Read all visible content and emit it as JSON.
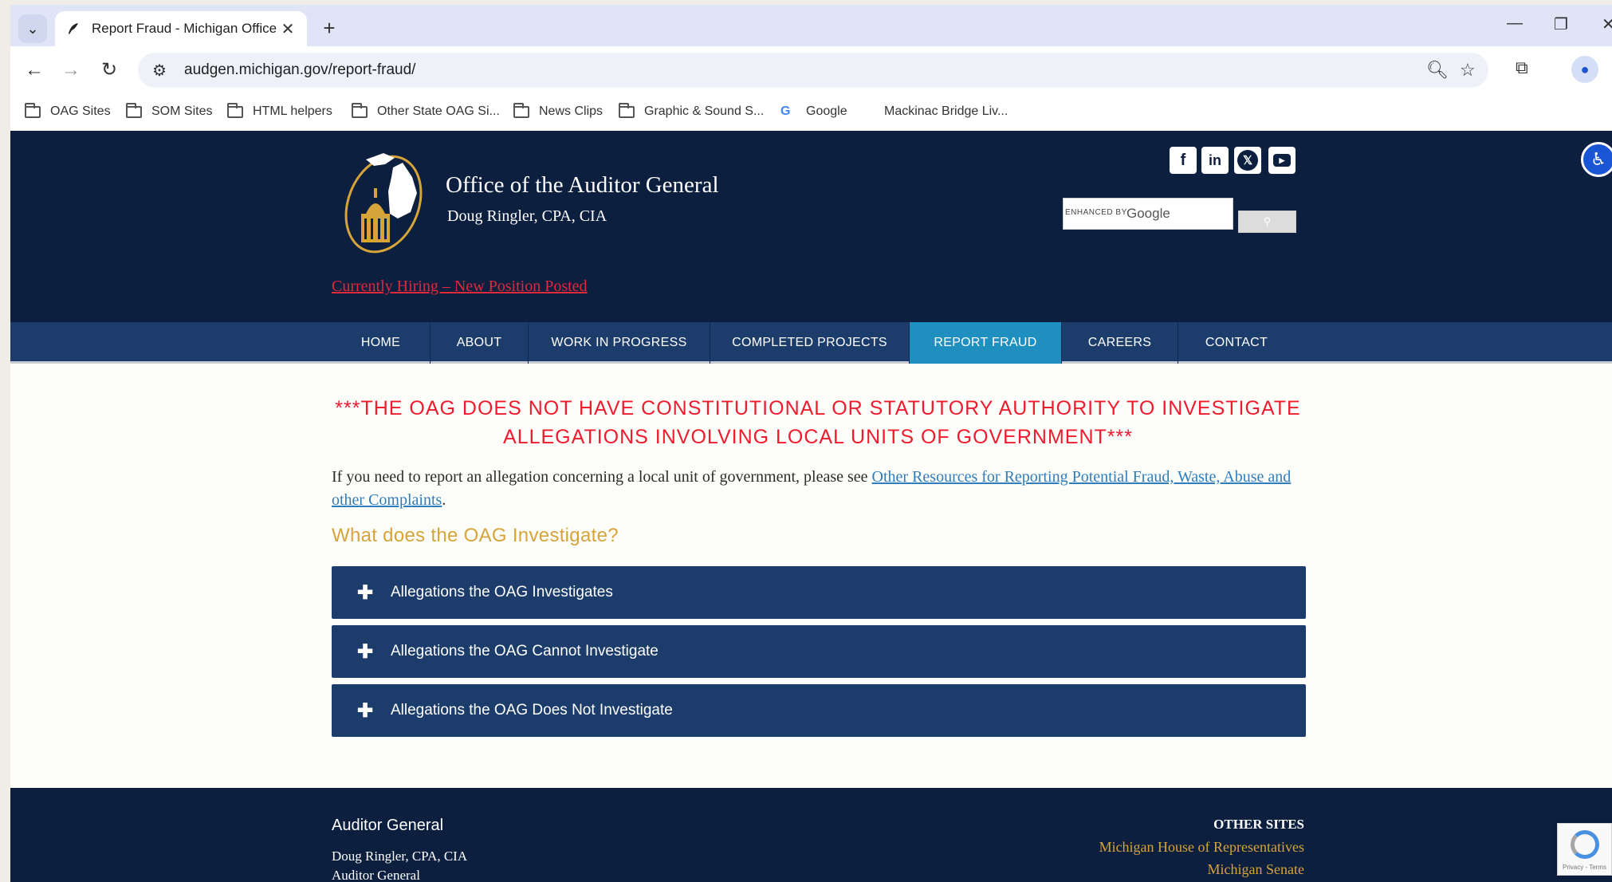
{
  "browser": {
    "tab_title": "Report Fraud - Michigan Office",
    "url": "audgen.michigan.gov/report-fraud/",
    "bookmarks": [
      {
        "label": "OAG Sites",
        "icon": "folder-icon"
      },
      {
        "label": "SOM Sites",
        "icon": "folder-icon"
      },
      {
        "label": "HTML helpers",
        "icon": "folder-icon"
      },
      {
        "label": "Other State OAG Si...",
        "icon": "folder-icon"
      },
      {
        "label": "News Clips",
        "icon": "folder-icon"
      },
      {
        "label": "Graphic & Sound S...",
        "icon": "folder-icon"
      },
      {
        "label": "Google",
        "icon": "google-icon"
      },
      {
        "label": "Mackinac Bridge Liv...",
        "icon": "none"
      }
    ]
  },
  "header": {
    "org_name": "Office of the Auditor General",
    "org_sub": "Doug Ringler, CPA, CIA",
    "hiring_link": "Currently Hiring – New Position Posted",
    "social": [
      "facebook-icon",
      "linkedin-icon",
      "x-icon",
      "youtube-icon"
    ],
    "search_label": "ENHANCED BY",
    "search_brand": "Google"
  },
  "nav": {
    "items": [
      "HOME",
      "ABOUT",
      "WORK IN PROGRESS",
      "COMPLETED PROJECTS",
      "REPORT FRAUD",
      "CAREERS",
      "CONTACT"
    ],
    "active": "REPORT FRAUD"
  },
  "main": {
    "notice": "***THE OAG DOES NOT HAVE CONSTITUTIONAL OR STATUTORY AUTHORITY TO INVESTIGATE ALLEGATIONS INVOLVING LOCAL UNITS OF GOVERNMENT***",
    "intro_text": "If you need to report an allegation concerning a local unit of government, please see ",
    "intro_link": "Other Resources for Reporting Potential Fraud, Waste, Abuse and other Complaints",
    "intro_end": ".",
    "section_heading": "What does the OAG Investigate?",
    "accordions": [
      "Allegations the OAG Investigates",
      "Allegations the OAG Cannot Investigate",
      "Allegations the OAG Does Not Investigate"
    ]
  },
  "footer": {
    "title": "Auditor General",
    "name": "Doug Ringler, CPA, CIA",
    "role": "Auditor General",
    "other_sites_heading": "OTHER SITES",
    "other_sites": [
      "Michigan House of Representatives",
      "Michigan Senate"
    ]
  },
  "recaptcha_text": "Privacy - Terms",
  "colors": {
    "header_bg": "#0c1f3f",
    "nav_bg": "#1c3d6b",
    "nav_active": "#1f8fbf",
    "notice_red": "#ee1c2e",
    "gold": "#d7a43a",
    "link_blue": "#2f7dbd"
  }
}
